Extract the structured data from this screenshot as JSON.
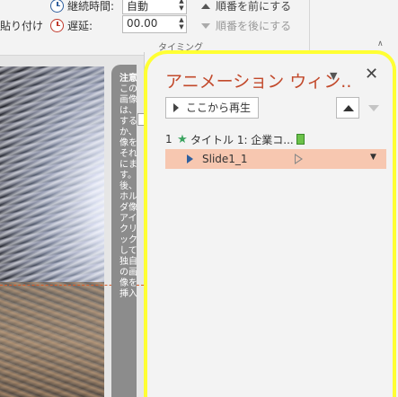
{
  "ribbon": {
    "paste_label": "貼り付け",
    "duration_label": "継続時間:",
    "duration_value": "自動",
    "delay_label": "遅延:",
    "delay_value": "00.00",
    "move_earlier": "順番を前にする",
    "move_later": "順番を後にする",
    "group_label": "タイミング"
  },
  "slide": {
    "note_title": "注意",
    "note_body": "この画像は、するか、像をそれにます。後、ホルダ像アイクリックして独自の画像を挿入"
  },
  "pane": {
    "title": "アニメーション ウィン..",
    "play_label": "ここから再生",
    "items": [
      {
        "number": "1",
        "label": "タイトル 1: 企業コ..."
      },
      {
        "label": "Slide1_1"
      }
    ]
  },
  "colors": {
    "title": "#c2492b",
    "selected_row": "#f7c7b0",
    "highlight": "#ffff33",
    "effect_icon": "#3aa35f"
  },
  "icons": {
    "effect": "star-icon",
    "play": "play-icon",
    "close": "close-icon",
    "trigger": "trigger-icon"
  }
}
